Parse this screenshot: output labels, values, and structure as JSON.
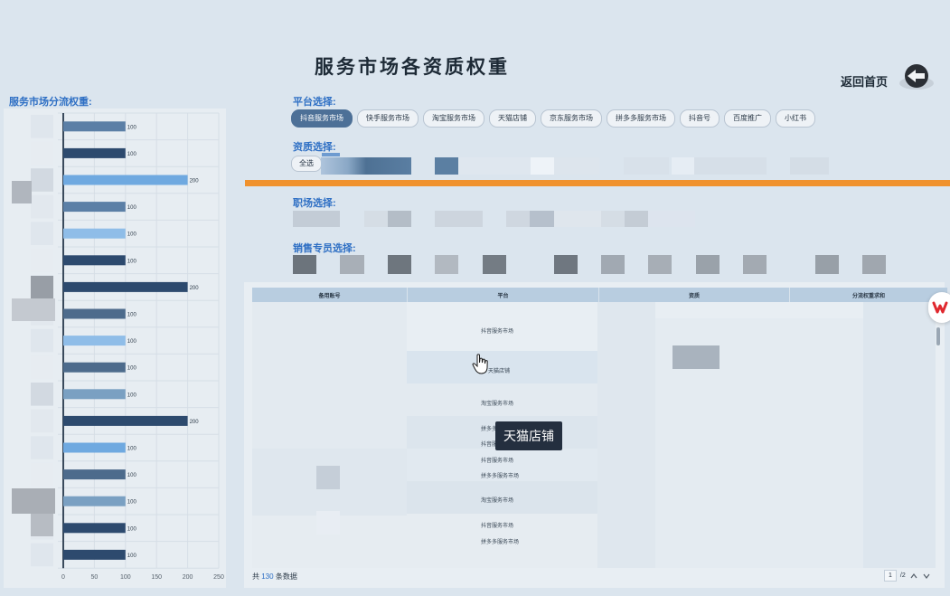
{
  "header": {
    "title": "服务市场各资质权重",
    "home_label": "返回首页"
  },
  "left_chart": {
    "title": "服务市场分流权重:"
  },
  "chart_data": {
    "type": "bar",
    "orientation": "horizontal",
    "values": [
      100,
      100,
      200,
      100,
      100,
      100,
      200,
      100,
      100,
      100,
      100,
      200,
      100,
      100,
      100,
      100,
      100
    ],
    "bar_colors": [
      "#5b7fa6",
      "#2d4a6e",
      "#6fa9e0",
      "#5b7fa6",
      "#8fbde8",
      "#2d4a6e",
      "#2d4a6e",
      "#4d6b8c",
      "#8fbde8",
      "#4d6b8c",
      "#7aa0c2",
      "#2d4a6e",
      "#6fa9e0",
      "#4d6b8c",
      "#7aa0c2",
      "#2d4a6e",
      "#2d4a6e"
    ],
    "xlim": [
      0,
      250
    ],
    "x_ticks": [
      "0",
      "50",
      "100",
      "150",
      "200",
      "250"
    ],
    "grid": true
  },
  "filters": {
    "platform_label": "平台选择:",
    "platforms": [
      "抖音服务市场",
      "快手服务市场",
      "淘宝服务市场",
      "天猫店铺",
      "京东服务市场",
      "拼多多服务市场",
      "抖音号",
      "百度推广",
      "小红书"
    ],
    "active_platform": "抖音服务市场",
    "qualification_label": "资质选择:",
    "select_all": "全选",
    "workplace_label": "职场选择:",
    "sales_label": "销售专员选择:"
  },
  "table": {
    "columns": [
      "备用账号",
      "平台",
      "资质",
      "分流权重求和"
    ],
    "platform_cells": [
      "抖音服务市场",
      "天猫店铺",
      "淘宝服务市场",
      "拼多多服务市场",
      "抖音服务市场",
      "抖音服务市场",
      "拼多多服务市场",
      "淘宝服务市场",
      "抖音服务市场",
      "拼多多服务市场"
    ],
    "total_prefix": "共",
    "total_count": "130",
    "total_suffix": "条数据",
    "page_current": "1",
    "page_total": "/2"
  },
  "tooltip": {
    "text": "天猫店铺"
  },
  "colors": {
    "accent": "#2e6fc4",
    "orange": "#f0922e",
    "active_chip": "#4d7097"
  }
}
